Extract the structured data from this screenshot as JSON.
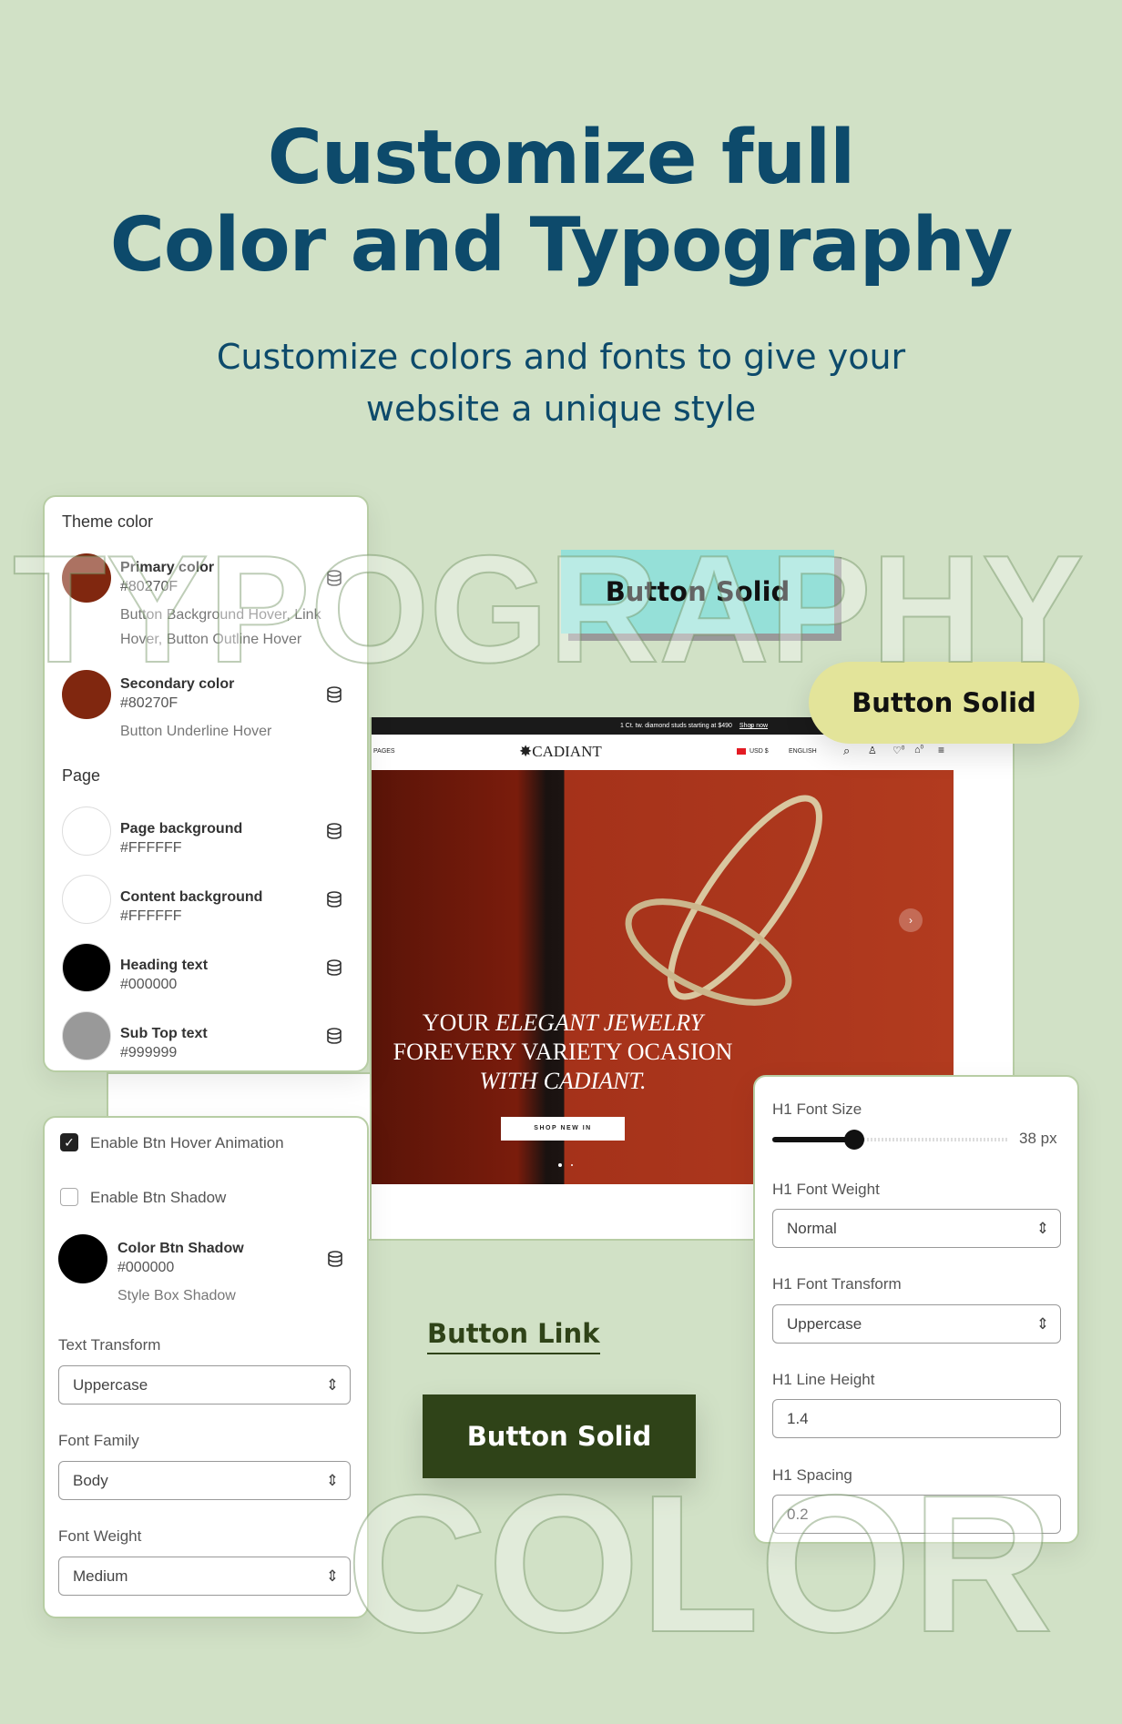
{
  "headline": {
    "line1": "Customize full",
    "line2": "Color and Typography",
    "subtitle_line1": "Customize colors and fonts to give your",
    "subtitle_line2": "website a unique style"
  },
  "watermarks": {
    "top": "TYPOGRAPHY",
    "bottom": "COLOR"
  },
  "colors": {
    "background": "#d1e1c6",
    "heading": "#0d4a6b",
    "teal_button": "#95e0d8",
    "yellow_button": "#e3e49a",
    "dark_button": "#2f4318",
    "primary": "#80270F"
  },
  "theme_panel": {
    "title": "Theme color",
    "page_title": "Page",
    "theme_items": [
      {
        "label": "Primary color",
        "hex": "#80270F",
        "desc1": "Button Background Hover, Link",
        "desc2": "Hover, Button Outline Hover",
        "swatch": "#80270F"
      },
      {
        "label": "Secondary color",
        "hex": "#80270F",
        "desc1": "Button Underline Hover",
        "swatch": "#80270F"
      }
    ],
    "page_items": [
      {
        "label": "Page background",
        "hex": "#FFFFFF",
        "swatch": "#FFFFFF"
      },
      {
        "label": "Content background",
        "hex": "#FFFFFF",
        "swatch": "#FFFFFF"
      },
      {
        "label": "Heading text",
        "hex": "#000000",
        "swatch": "#000000"
      },
      {
        "label": "Sub Top text",
        "hex": "#999999",
        "swatch": "#999999"
      }
    ],
    "icon": "database-icon"
  },
  "buttons": {
    "solid_teal": "Button Solid",
    "solid_yellow": "Button Solid",
    "link": "Button Link",
    "solid_dark": "Button Solid"
  },
  "website": {
    "announcement": "1 Ct. tw. diamond studs starting at $490",
    "announcement_link": "Shop now",
    "nav_pages": "PAGES",
    "logo": "CADIANT",
    "currency": "USD $",
    "language": "ENGLISH",
    "wishlist_count": "0",
    "cart_count": "0",
    "hero_line1a": "YOUR ",
    "hero_line1b": "ELEGANT JEWELRY",
    "hero_line2": "FOREVERY VARIETY OCASION",
    "hero_line3": "WITH CADIANT.",
    "hero_button": "SHOP NEW IN"
  },
  "button_panel": {
    "hover_animation": {
      "label": "Enable Btn Hover Animation",
      "checked": true
    },
    "shadow": {
      "label": "Enable Btn Shadow",
      "checked": false
    },
    "shadow_color": {
      "label": "Color Btn Shadow",
      "hex": "#000000",
      "desc": "Style Box Shadow"
    },
    "text_transform": {
      "label": "Text Transform",
      "value": "Uppercase"
    },
    "font_family": {
      "label": "Font Family",
      "value": "Body"
    },
    "font_weight": {
      "label": "Font Weight",
      "value": "Medium"
    }
  },
  "h1_panel": {
    "font_size": {
      "label": "H1 Font Size",
      "value": "38 px",
      "slider_fraction": 0.35
    },
    "font_weight": {
      "label": "H1 Font Weight",
      "value": "Normal"
    },
    "font_transform": {
      "label": "H1 Font Transform",
      "value": "Uppercase"
    },
    "line_height": {
      "label": "H1 Line Height",
      "value": "1.4"
    },
    "spacing": {
      "label": "H1 Spacing",
      "value": "0.2"
    }
  }
}
